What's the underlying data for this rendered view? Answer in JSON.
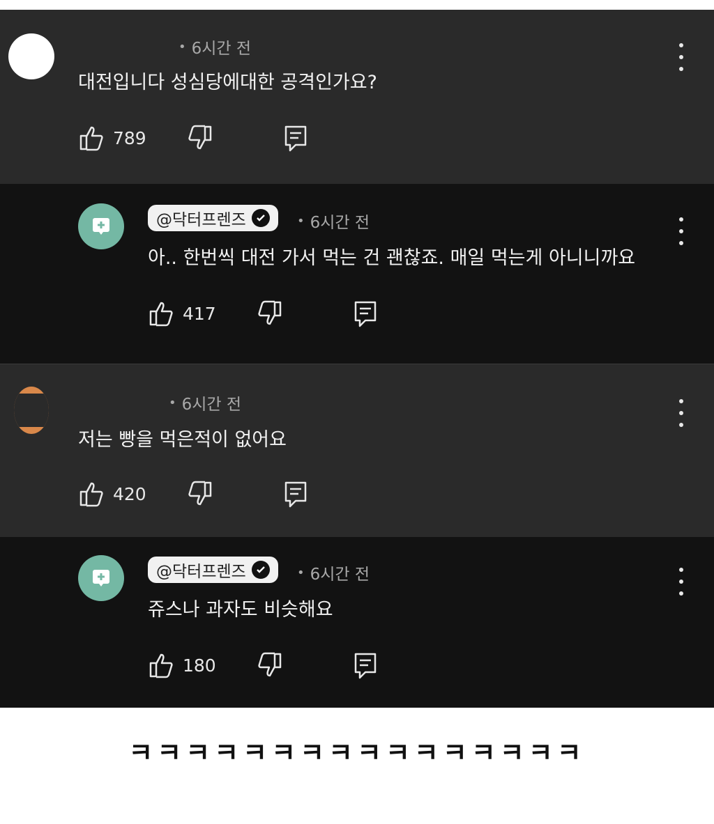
{
  "threads": [
    {
      "comment": {
        "time": "6시간 전",
        "text": "대전입니다 성심당에대한 공격인가요?",
        "likes": "789"
      },
      "reply": {
        "handle": "@닥터프렌즈",
        "time": "6시간 전",
        "text": "아.. 한번씩 대전 가서 먹는 건 괜찮죠. 매일 먹는게 아니니까요",
        "likes": "417"
      }
    },
    {
      "comment": {
        "time": "6시간 전",
        "text": "저는 빵을 먹은적이 없어요",
        "likes": "420"
      },
      "reply": {
        "handle": "@닥터프렌즈",
        "time": "6시간 전",
        "text": "쥬스나 과자도 비슷해요",
        "likes": "180"
      }
    }
  ],
  "caption": "ㅋㅋㅋㅋㅋㅋㅋㅋㅋㅋㅋㅋㅋㅋㅋㅋ",
  "colors": {
    "comment_bg": "#2a2a2a",
    "reply_bg": "#121212",
    "teal_avatar": "#74b8a4",
    "orange_avatar": "#d9884a"
  },
  "icons": [
    "thumbs-up-icon",
    "thumbs-down-icon",
    "reply-icon",
    "more-vert-icon",
    "check-badge-icon",
    "channel-avatar-icon"
  ]
}
